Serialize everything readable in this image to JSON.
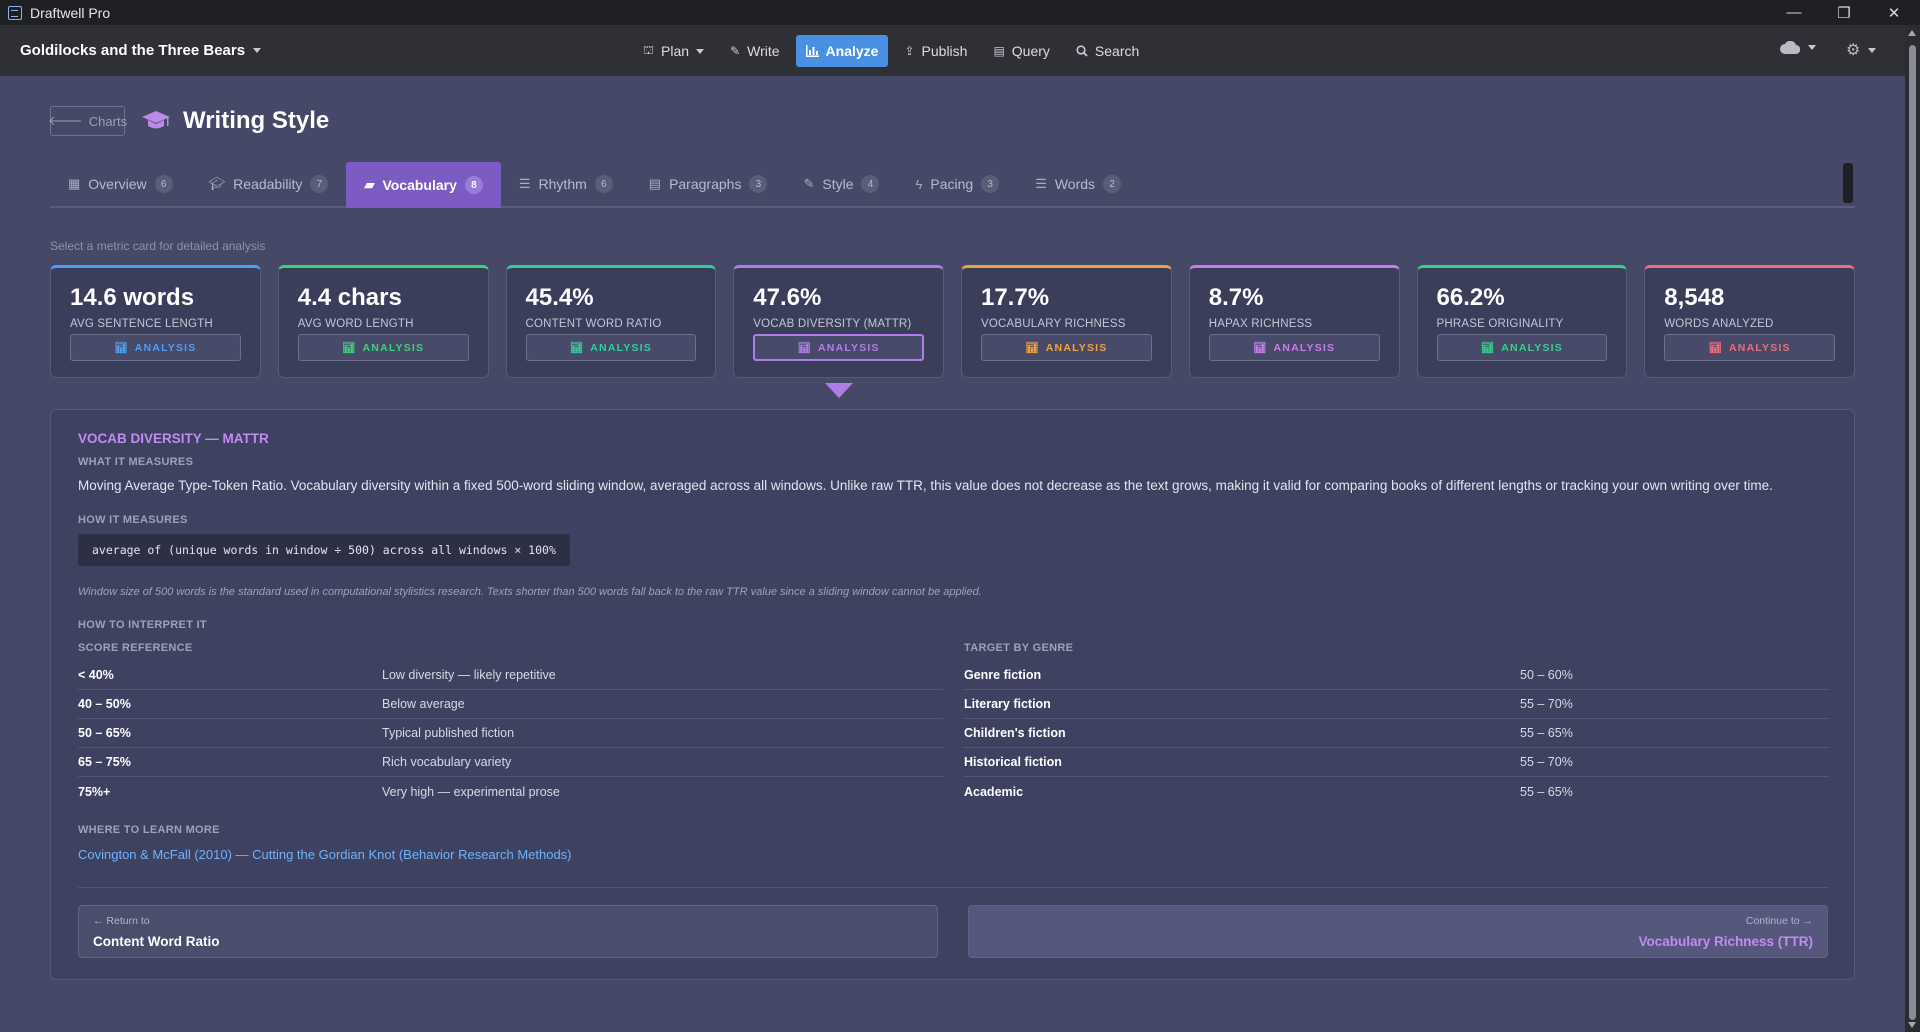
{
  "window": {
    "title": "Draftwell Pro",
    "minimize": "—",
    "maximize": "❐",
    "close": "✕"
  },
  "topnav": {
    "project": "Goldilocks and the Three Bears",
    "items": [
      {
        "label": "Plan",
        "icon": "sitemap-icon"
      },
      {
        "label": "Write",
        "icon": "pencil-icon"
      },
      {
        "label": "Analyze",
        "icon": "bar-chart-icon",
        "active": true
      },
      {
        "label": "Publish",
        "icon": "upload-icon"
      },
      {
        "label": "Query",
        "icon": "table-icon"
      },
      {
        "label": "Search",
        "icon": "search-icon"
      }
    ]
  },
  "header": {
    "back_label": "Charts",
    "title": "Writing Style"
  },
  "tabs": [
    {
      "label": "Overview",
      "count": "6"
    },
    {
      "label": "Readability",
      "count": "7"
    },
    {
      "label": "Vocabulary",
      "count": "8",
      "active": true
    },
    {
      "label": "Rhythm",
      "count": "6"
    },
    {
      "label": "Paragraphs",
      "count": "3"
    },
    {
      "label": "Style",
      "count": "4"
    },
    {
      "label": "Pacing",
      "count": "3"
    },
    {
      "label": "Words",
      "count": "2"
    }
  ],
  "hint": "Select a metric card for detailed analysis",
  "cards": [
    {
      "value": "14.6 words",
      "label": "AVG SENTENCE LENGTH",
      "color": "#4a9ff5"
    },
    {
      "value": "4.4 chars",
      "label": "AVG WORD LENGTH",
      "color": "#3cd07c"
    },
    {
      "value": "45.4%",
      "label": "CONTENT WORD RATIO",
      "color": "#2fcf9a"
    },
    {
      "value": "47.6%",
      "label": "VOCAB DIVERSITY (MATTR)",
      "color": "#b07ce8",
      "selected": true
    },
    {
      "value": "17.7%",
      "label": "VOCABULARY RICHNESS",
      "color": "#f2a03d"
    },
    {
      "value": "8.7%",
      "label": "HAPAX RICHNESS",
      "color": "#c77de8"
    },
    {
      "value": "66.2%",
      "label": "PHRASE ORIGINALITY",
      "color": "#36cf8e"
    },
    {
      "value": "8,548",
      "label": "WORDS ANALYZED",
      "color": "#f06b7e"
    }
  ],
  "analysis_label": "ANALYSIS",
  "detail": {
    "title": "VOCAB DIVERSITY — MATTR",
    "what_label": "WHAT IT MEASURES",
    "what_text": "Moving Average Type-Token Ratio. Vocabulary diversity within a fixed 500-word sliding window, averaged across all windows. Unlike raw TTR, this value does not decrease as the text grows, making it valid for comparing books of different lengths or tracking your own writing over time.",
    "how_label": "HOW IT MEASURES",
    "formula": "average of (unique words in window ÷ 500) across all windows × 100%",
    "note": "Window size of 500 words is the standard used in computational stylistics research. Texts shorter than 500 words fall back to the raw TTR value since a sliding window cannot be applied.",
    "interpret_label": "HOW TO INTERPRET IT",
    "score_label": "SCORE REFERENCE",
    "scores": [
      {
        "range": "< 40%",
        "meaning": "Low diversity — likely repetitive"
      },
      {
        "range": "40 – 50%",
        "meaning": "Below average"
      },
      {
        "range": "50 – 65%",
        "meaning": "Typical published fiction"
      },
      {
        "range": "65 – 75%",
        "meaning": "Rich vocabulary variety"
      },
      {
        "range": "75%+",
        "meaning": "Very high — experimental prose"
      }
    ],
    "genre_label": "TARGET BY GENRE",
    "genres": [
      {
        "genre": "Genre fiction",
        "target": "50 – 60%"
      },
      {
        "genre": "Literary fiction",
        "target": "55 – 70%"
      },
      {
        "genre": "Children's fiction",
        "target": "55 – 65%"
      },
      {
        "genre": "Historical fiction",
        "target": "55 – 70%"
      },
      {
        "genre": "Academic",
        "target": "55 – 65%"
      }
    ],
    "learn_label": "WHERE TO LEARN MORE",
    "learn_link": "Covington & McFall (2010) — Cutting the Gordian Knot (Behavior Research Methods)",
    "prev": {
      "small": "← Return to",
      "title": "Content Word Ratio"
    },
    "next": {
      "small": "Continue to →",
      "title": "Vocabulary Richness (TTR)"
    }
  }
}
